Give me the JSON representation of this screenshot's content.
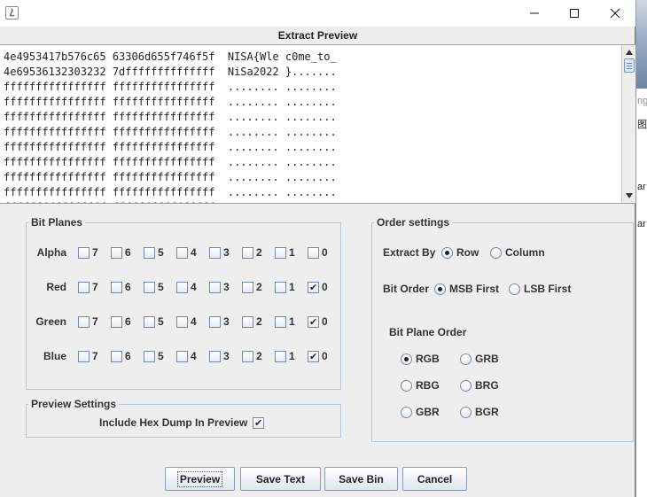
{
  "dialog": {
    "title": "Extract Preview",
    "window_controls": {
      "minimize_icon": "minimize-icon",
      "maximize_icon": "maximize-icon",
      "close_icon": "close-icon"
    }
  },
  "preview": {
    "lines": [
      "4e4953417b576c65 63306d655f746f5f  NISA{Wle c0me_to_",
      "4e69536132303232 7dffffffffffffff  NiSa2022 }.......",
      "ffffffffffffffff ffffffffffffffff  ........ ........",
      "ffffffffffffffff ffffffffffffffff  ........ ........",
      "ffffffffffffffff ffffffffffffffff  ........ ........",
      "ffffffffffffffff ffffffffffffffff  ........ ........",
      "ffffffffffffffff ffffffffffffffff  ........ ........",
      "ffffffffffffffff ffffffffffffffff  ........ ........",
      "ffffffffffffffff ffffffffffffffff  ........ ........",
      "ffffffffffffffff ffffffffffffffff  ........ ........",
      "ffffffffffffffff ffffffffffffffff  ........ ........"
    ]
  },
  "bit_planes": {
    "title": "Bit Planes",
    "rows": [
      {
        "channel": "Alpha",
        "bits": [
          "7",
          "6",
          "5",
          "4",
          "3",
          "2",
          "1",
          "0"
        ],
        "checked": [
          false,
          false,
          false,
          false,
          false,
          false,
          false,
          false
        ]
      },
      {
        "channel": "Red",
        "bits": [
          "7",
          "6",
          "5",
          "4",
          "3",
          "2",
          "1",
          "0"
        ],
        "checked": [
          false,
          false,
          false,
          false,
          false,
          false,
          false,
          true
        ]
      },
      {
        "channel": "Green",
        "bits": [
          "7",
          "6",
          "5",
          "4",
          "3",
          "2",
          "1",
          "0"
        ],
        "checked": [
          false,
          false,
          false,
          false,
          false,
          false,
          false,
          true
        ]
      },
      {
        "channel": "Blue",
        "bits": [
          "7",
          "6",
          "5",
          "4",
          "3",
          "2",
          "1",
          "0"
        ],
        "checked": [
          false,
          false,
          false,
          false,
          false,
          false,
          false,
          true
        ]
      }
    ]
  },
  "preview_settings": {
    "title": "Preview Settings",
    "include_hex_label": "Include Hex Dump In Preview",
    "include_hex_checked": true
  },
  "order_settings": {
    "title": "Order settings",
    "extract_by_label": "Extract By",
    "extract_by_options": [
      "Row",
      "Column"
    ],
    "extract_by_selected": "Row",
    "bit_order_label": "Bit Order",
    "bit_order_options": [
      "MSB First",
      "LSB First"
    ],
    "bit_order_selected": "MSB First",
    "bit_plane_order_label": "Bit Plane Order",
    "bit_plane_order_options": [
      "RGB",
      "GRB",
      "RBG",
      "BRG",
      "GBR",
      "BGR"
    ],
    "bit_plane_order_selected": "RGB"
  },
  "buttons": {
    "preview": "Preview",
    "save_text": "Save Text",
    "save_bin": "Save Bin",
    "cancel": "Cancel"
  },
  "background_window": {
    "texts": [
      "ng",
      "图(",
      "ar",
      "ar"
    ]
  }
}
